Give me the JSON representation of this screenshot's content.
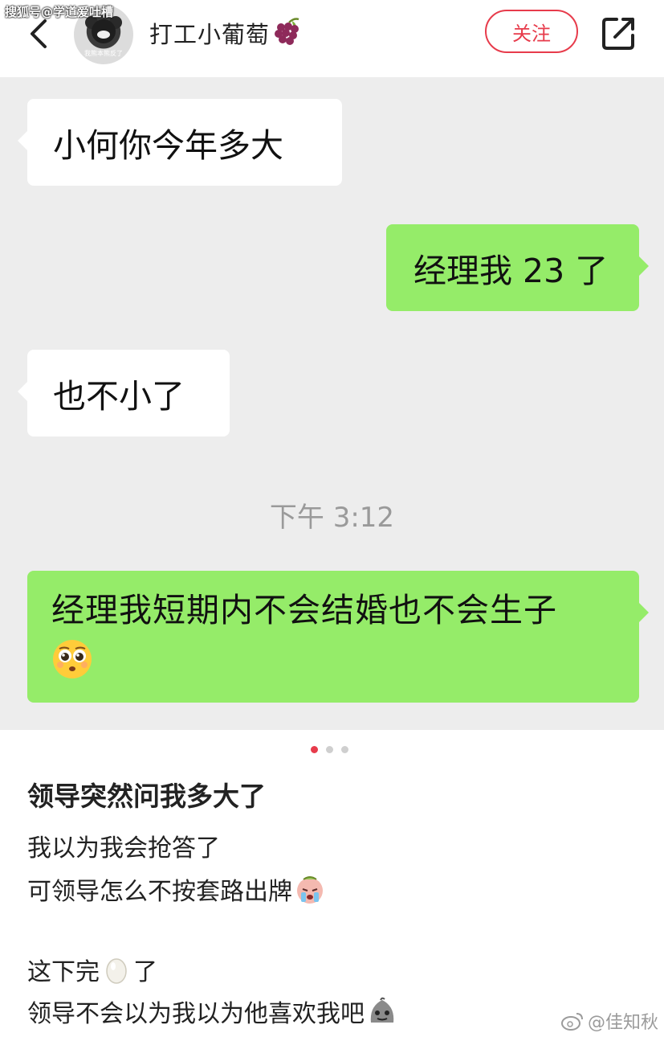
{
  "watermark_top": "搜狐号@学道爱吐槽",
  "header": {
    "avatar_caption": "我熊本熊反了",
    "username": "打工小葡萄",
    "follow_label": "关注"
  },
  "chat": {
    "messages": [
      {
        "side": "left",
        "text": "小何你今年多大"
      },
      {
        "side": "right",
        "text": "经理我 23 了"
      },
      {
        "side": "left",
        "text": "也不小了"
      },
      {
        "side": "right",
        "text": "经理我短期内不会结婚也不会生子"
      }
    ],
    "time": "下午 3:12"
  },
  "pager": {
    "total": 3,
    "active": 0
  },
  "post": {
    "title": "领导突然问我多大了",
    "line1": "我以为我会抢答了",
    "line2": "可领导怎么不按套路出牌",
    "line3_before": "这下完",
    "line3_after": "了",
    "line4": "领导不会以为我以为他喜欢我吧"
  },
  "watermark_bottom": "@佳知秋",
  "colors": {
    "accent": "#e73b4b",
    "bubble_right": "#95ec69",
    "bubble_left": "#ffffff",
    "chat_bg": "#ededed"
  },
  "icons": [
    "back-icon",
    "grape-icon",
    "share-icon",
    "pleading-face-icon",
    "crying-face-icon",
    "egg-icon",
    "mischief-face-icon",
    "weibo-icon"
  ]
}
